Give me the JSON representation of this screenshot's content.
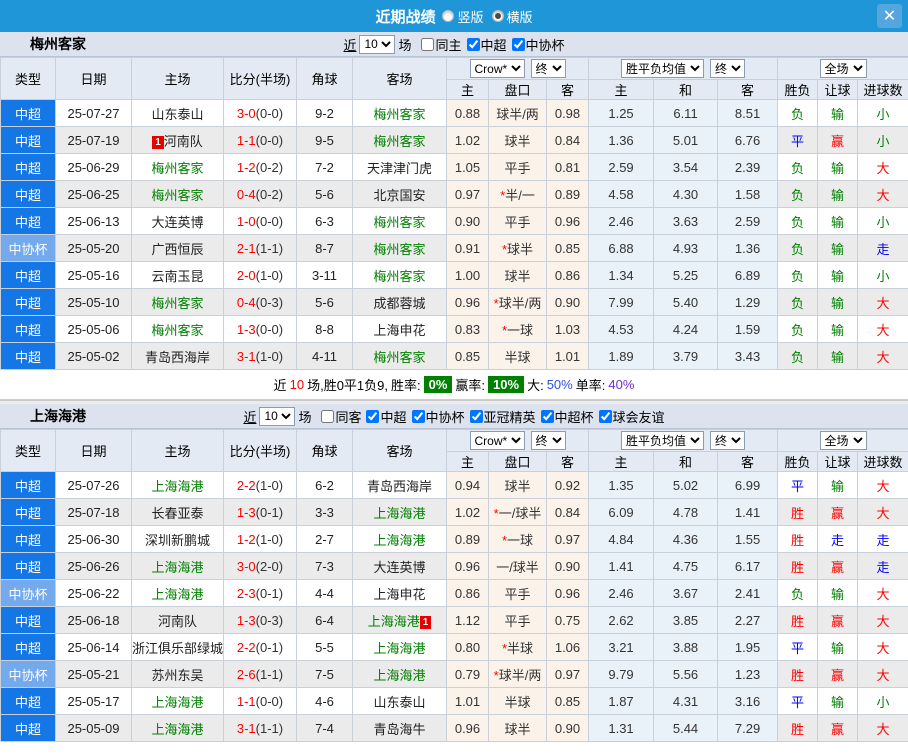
{
  "titlebar": {
    "title": "近期战绩",
    "layout_options": [
      {
        "label": "竖版",
        "selected": false
      },
      {
        "label": "横版",
        "selected": true
      }
    ],
    "close_icon": "✕"
  },
  "colors": {
    "titlebar": "#1e96d7",
    "league_chs": "#1577e6",
    "league_cup": "#74aaec",
    "win": "#ff0000",
    "draw": "#0000ff",
    "lose": "#008000",
    "team_highlight": "#008000",
    "score": "#ff0000",
    "rate_badge": "#008000"
  },
  "table": {
    "col_headers": [
      "类型",
      "日期",
      "主场",
      "比分(半场)",
      "角球",
      "客场"
    ],
    "sub_headers": [
      "主",
      "盘口",
      "客",
      "主",
      "和",
      "客",
      "胜负",
      "让球",
      "进球数"
    ],
    "selects": {
      "bookmaker": "Crow*",
      "bookmaker_final": "终",
      "europe_avg": "胜平负均值",
      "europe_final": "终",
      "scope": "全场"
    },
    "star_mark": "*"
  },
  "sections": [
    {
      "team": "梅州客家",
      "filter": {
        "near": "近",
        "count": "10",
        "unit": "场",
        "options": [
          {
            "label": "同主",
            "checked": false
          },
          {
            "label": "中超",
            "checked": true
          },
          {
            "label": "中协杯",
            "checked": true
          }
        ]
      },
      "rows": [
        {
          "type": "中超",
          "date": "25-07-27",
          "home": "山东泰山",
          "ft": "3-0",
          "ht": "(0-0)",
          "corner": "9-2",
          "away": "梅州客家",
          "o1": "0.88",
          "star": false,
          "handicap": "球半/两",
          "o2": "0.98",
          "e1": "1.25",
          "e2": "6.11",
          "e3": "8.51",
          "r1": "负",
          "r2": "输",
          "r3": "小"
        },
        {
          "type": "中超",
          "date": "25-07-19",
          "home": "河南队",
          "home_badge": "1",
          "ft": "1-1",
          "ht": "(0-0)",
          "corner": "9-5",
          "away": "梅州客家",
          "o1": "1.02",
          "star": false,
          "handicap": "球半",
          "o2": "0.84",
          "e1": "1.36",
          "e2": "5.01",
          "e3": "6.76",
          "r1": "平",
          "r2": "赢",
          "r3": "小"
        },
        {
          "type": "中超",
          "date": "25-06-29",
          "home": "梅州客家",
          "ft": "1-2",
          "ht": "(0-2)",
          "corner": "7-2",
          "away": "天津津门虎",
          "o1": "1.05",
          "star": false,
          "handicap": "平手",
          "o2": "0.81",
          "e1": "2.59",
          "e2": "3.54",
          "e3": "2.39",
          "r1": "负",
          "r2": "输",
          "r3": "大"
        },
        {
          "type": "中超",
          "date": "25-06-25",
          "home": "梅州客家",
          "ft": "0-4",
          "ht": "(0-2)",
          "corner": "5-6",
          "away": "北京国安",
          "o1": "0.97",
          "star": true,
          "handicap": "半/一",
          "o2": "0.89",
          "e1": "4.58",
          "e2": "4.30",
          "e3": "1.58",
          "r1": "负",
          "r2": "输",
          "r3": "大"
        },
        {
          "type": "中超",
          "date": "25-06-13",
          "home": "大连英博",
          "ft": "1-0",
          "ht": "(0-0)",
          "corner": "6-3",
          "away": "梅州客家",
          "o1": "0.90",
          "star": false,
          "handicap": "平手",
          "o2": "0.96",
          "e1": "2.46",
          "e2": "3.63",
          "e3": "2.59",
          "r1": "负",
          "r2": "输",
          "r3": "小"
        },
        {
          "type": "中协杯",
          "date": "25-05-20",
          "home": "广西恒辰",
          "ft": "2-1",
          "ht": "(1-1)",
          "corner": "8-7",
          "away": "梅州客家",
          "o1": "0.91",
          "star": true,
          "handicap": "球半",
          "o2": "0.85",
          "e1": "6.88",
          "e2": "4.93",
          "e3": "1.36",
          "r1": "负",
          "r2": "输",
          "r3": "走"
        },
        {
          "type": "中超",
          "date": "25-05-16",
          "home": "云南玉昆",
          "ft": "2-0",
          "ht": "(1-0)",
          "corner": "3-11",
          "away": "梅州客家",
          "o1": "1.00",
          "star": false,
          "handicap": "球半",
          "o2": "0.86",
          "e1": "1.34",
          "e2": "5.25",
          "e3": "6.89",
          "r1": "负",
          "r2": "输",
          "r3": "小"
        },
        {
          "type": "中超",
          "date": "25-05-10",
          "home": "梅州客家",
          "ft": "0-4",
          "ht": "(0-3)",
          "corner": "5-6",
          "away": "成都蓉城",
          "o1": "0.96",
          "star": true,
          "handicap": "球半/两",
          "o2": "0.90",
          "e1": "7.99",
          "e2": "5.40",
          "e3": "1.29",
          "r1": "负",
          "r2": "输",
          "r3": "大"
        },
        {
          "type": "中超",
          "date": "25-05-06",
          "home": "梅州客家",
          "ft": "1-3",
          "ht": "(0-0)",
          "corner": "8-8",
          "away": "上海申花",
          "o1": "0.83",
          "star": true,
          "handicap": "一球",
          "o2": "1.03",
          "e1": "4.53",
          "e2": "4.24",
          "e3": "1.59",
          "r1": "负",
          "r2": "输",
          "r3": "大"
        },
        {
          "type": "中超",
          "date": "25-05-02",
          "home": "青岛西海岸",
          "ft": "3-1",
          "ht": "(1-0)",
          "corner": "4-11",
          "away": "梅州客家",
          "o1": "0.85",
          "star": false,
          "handicap": "半球",
          "o2": "1.01",
          "e1": "1.89",
          "e2": "3.79",
          "e3": "3.43",
          "r1": "负",
          "r2": "输",
          "r3": "大"
        }
      ],
      "summary": {
        "prefix": "近",
        "count": "10",
        "middle": "场,胜0平1负9,",
        "win_label": "胜率:",
        "win_rate": "0%",
        "earn_label": "赢率:",
        "earn_rate": "10%",
        "big_label": "大:",
        "big_rate": "50%",
        "single_label": "单率:",
        "single_rate": "40%"
      }
    },
    {
      "team": "上海海港",
      "filter": {
        "near": "近",
        "count": "10",
        "unit": "场",
        "options": [
          {
            "label": "同客",
            "checked": false
          },
          {
            "label": "中超",
            "checked": true
          },
          {
            "label": "中协杯",
            "checked": true
          },
          {
            "label": "亚冠精英",
            "checked": true
          },
          {
            "label": "中超杯",
            "checked": true
          },
          {
            "label": "球会友谊",
            "checked": true
          }
        ]
      },
      "rows": [
        {
          "type": "中超",
          "date": "25-07-26",
          "home": "上海海港",
          "ft": "2-2",
          "ht": "(1-0)",
          "corner": "6-2",
          "away": "青岛西海岸",
          "o1": "0.94",
          "star": false,
          "handicap": "球半",
          "o2": "0.92",
          "e1": "1.35",
          "e2": "5.02",
          "e3": "6.99",
          "r1": "平",
          "r2": "输",
          "r3": "大"
        },
        {
          "type": "中超",
          "date": "25-07-18",
          "home": "长春亚泰",
          "ft": "1-3",
          "ht": "(0-1)",
          "corner": "3-3",
          "away": "上海海港",
          "o1": "1.02",
          "star": true,
          "handicap": "一/球半",
          "o2": "0.84",
          "e1": "6.09",
          "e2": "4.78",
          "e3": "1.41",
          "r1": "胜",
          "r2": "赢",
          "r3": "大"
        },
        {
          "type": "中超",
          "date": "25-06-30",
          "home": "深圳新鹏城",
          "ft": "1-2",
          "ht": "(1-0)",
          "corner": "2-7",
          "away": "上海海港",
          "o1": "0.89",
          "star": true,
          "handicap": "一球",
          "o2": "0.97",
          "e1": "4.84",
          "e2": "4.36",
          "e3": "1.55",
          "r1": "胜",
          "r2": "走",
          "r3": "走"
        },
        {
          "type": "中超",
          "date": "25-06-26",
          "home": "上海海港",
          "ft": "3-0",
          "ht": "(2-0)",
          "corner": "7-3",
          "away": "大连英博",
          "o1": "0.96",
          "star": false,
          "handicap": "一/球半",
          "o2": "0.90",
          "e1": "1.41",
          "e2": "4.75",
          "e3": "6.17",
          "r1": "胜",
          "r2": "赢",
          "r3": "走"
        },
        {
          "type": "中协杯",
          "date": "25-06-22",
          "home": "上海海港",
          "ft": "2-3",
          "ht": "(0-1)",
          "corner": "4-4",
          "away": "上海申花",
          "o1": "0.86",
          "star": false,
          "handicap": "平手",
          "o2": "0.96",
          "e1": "2.46",
          "e2": "3.67",
          "e3": "2.41",
          "r1": "负",
          "r2": "输",
          "r3": "大"
        },
        {
          "type": "中超",
          "date": "25-06-18",
          "home": "河南队",
          "ft": "1-3",
          "ht": "(0-3)",
          "corner": "6-4",
          "away": "上海海港",
          "away_badge": "1",
          "o1": "1.12",
          "star": false,
          "handicap": "平手",
          "o2": "0.75",
          "e1": "2.62",
          "e2": "3.85",
          "e3": "2.27",
          "r1": "胜",
          "r2": "赢",
          "r3": "大"
        },
        {
          "type": "中超",
          "date": "25-06-14",
          "home": "浙江俱乐部绿城",
          "ft": "2-2",
          "ht": "(0-1)",
          "corner": "5-5",
          "away": "上海海港",
          "o1": "0.80",
          "star": true,
          "handicap": "半球",
          "o2": "1.06",
          "e1": "3.21",
          "e2": "3.88",
          "e3": "1.95",
          "r1": "平",
          "r2": "输",
          "r3": "大"
        },
        {
          "type": "中协杯",
          "date": "25-05-21",
          "home": "苏州东吴",
          "ft": "2-6",
          "ht": "(1-1)",
          "corner": "7-5",
          "away": "上海海港",
          "o1": "0.79",
          "star": true,
          "handicap": "球半/两",
          "o2": "0.97",
          "e1": "9.79",
          "e2": "5.56",
          "e3": "1.23",
          "r1": "胜",
          "r2": "赢",
          "r3": "大"
        },
        {
          "type": "中超",
          "date": "25-05-17",
          "home": "上海海港",
          "ft": "1-1",
          "ht": "(0-0)",
          "corner": "4-6",
          "away": "山东泰山",
          "o1": "1.01",
          "star": false,
          "handicap": "半球",
          "o2": "0.85",
          "e1": "1.87",
          "e2": "4.31",
          "e3": "3.16",
          "r1": "平",
          "r2": "输",
          "r3": "小"
        },
        {
          "type": "中超",
          "date": "25-05-09",
          "home": "上海海港",
          "ft": "3-1",
          "ht": "(1-1)",
          "corner": "7-4",
          "away": "青岛海牛",
          "o1": "0.96",
          "star": false,
          "handicap": "球半",
          "o2": "0.90",
          "e1": "1.31",
          "e2": "5.44",
          "e3": "7.29",
          "r1": "胜",
          "r2": "赢",
          "r3": "大"
        }
      ],
      "summary": null
    }
  ]
}
